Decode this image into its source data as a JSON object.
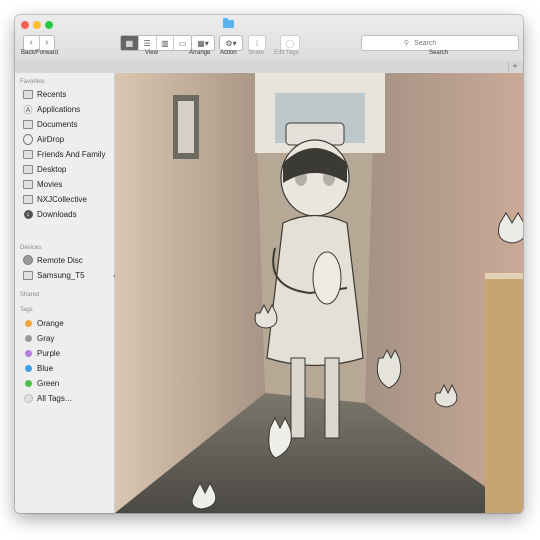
{
  "toolbar": {
    "back_forward_label": "Back/Forward",
    "view_label": "View",
    "arrange_label": "Arrange",
    "action_label": "Action",
    "share_label": "Share",
    "edit_tags_label": "Edit Tags",
    "search_label": "Search",
    "search_placeholder": "Search"
  },
  "sidebar": {
    "favorites_title": "Favorites",
    "favorites": [
      {
        "label": "Recents",
        "icon": "recents-icon"
      },
      {
        "label": "Applications",
        "icon": "applications-icon"
      },
      {
        "label": "Documents",
        "icon": "documents-icon"
      },
      {
        "label": "AirDrop",
        "icon": "airdrop-icon"
      },
      {
        "label": "Friends And Family",
        "icon": "folder-icon"
      },
      {
        "label": "Desktop",
        "icon": "desktop-icon"
      },
      {
        "label": "Movies",
        "icon": "movies-icon"
      },
      {
        "label": "NXJCollective",
        "icon": "folder-icon"
      },
      {
        "label": "Downloads",
        "icon": "downloads-icon"
      }
    ],
    "devices_title": "Devices",
    "devices": [
      {
        "label": "Remote Disc",
        "icon": "disc-icon"
      },
      {
        "label": "Samsung_T5",
        "icon": "drive-icon"
      }
    ],
    "shared_title": "Shared",
    "tags_title": "Tags",
    "tags": [
      {
        "label": "Orange",
        "color": "#f5a33a"
      },
      {
        "label": "Gray",
        "color": "#9b9b9b"
      },
      {
        "label": "Purple",
        "color": "#b57edc"
      },
      {
        "label": "Blue",
        "color": "#3fa0e8"
      },
      {
        "label": "Green",
        "color": "#4cc04c"
      },
      {
        "label": "All Tags...",
        "color": "#e0e0e0"
      }
    ]
  },
  "colors": {
    "close": "#fc5f57",
    "minimize": "#fdbc2e",
    "maximize": "#28c840",
    "folder_accent": "#59b4f0"
  }
}
